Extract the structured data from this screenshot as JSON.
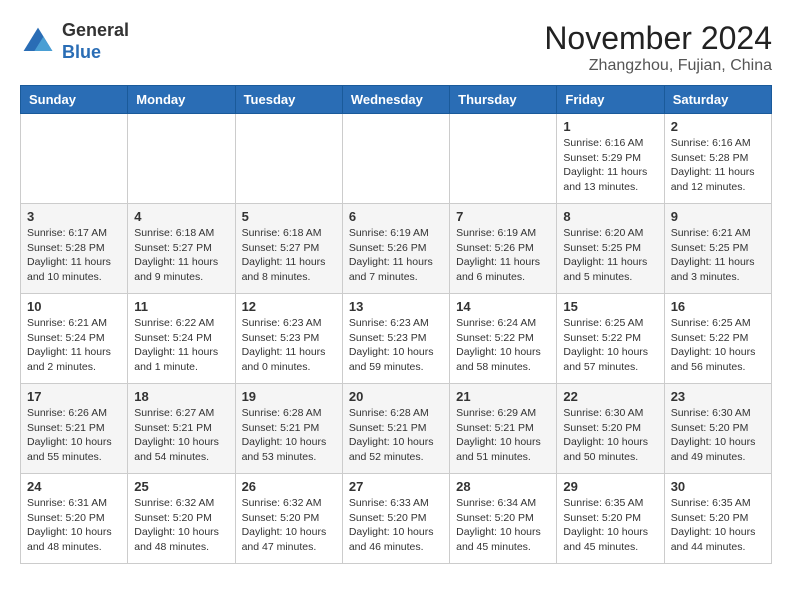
{
  "logo": {
    "text_general": "General",
    "text_blue": "Blue"
  },
  "header": {
    "month": "November 2024",
    "location": "Zhangzhou, Fujian, China"
  },
  "days_of_week": [
    "Sunday",
    "Monday",
    "Tuesday",
    "Wednesday",
    "Thursday",
    "Friday",
    "Saturday"
  ],
  "weeks": [
    [
      {
        "day": "",
        "info": ""
      },
      {
        "day": "",
        "info": ""
      },
      {
        "day": "",
        "info": ""
      },
      {
        "day": "",
        "info": ""
      },
      {
        "day": "",
        "info": ""
      },
      {
        "day": "1",
        "info": "Sunrise: 6:16 AM\nSunset: 5:29 PM\nDaylight: 11 hours and 13 minutes."
      },
      {
        "day": "2",
        "info": "Sunrise: 6:16 AM\nSunset: 5:28 PM\nDaylight: 11 hours and 12 minutes."
      }
    ],
    [
      {
        "day": "3",
        "info": "Sunrise: 6:17 AM\nSunset: 5:28 PM\nDaylight: 11 hours and 10 minutes."
      },
      {
        "day": "4",
        "info": "Sunrise: 6:18 AM\nSunset: 5:27 PM\nDaylight: 11 hours and 9 minutes."
      },
      {
        "day": "5",
        "info": "Sunrise: 6:18 AM\nSunset: 5:27 PM\nDaylight: 11 hours and 8 minutes."
      },
      {
        "day": "6",
        "info": "Sunrise: 6:19 AM\nSunset: 5:26 PM\nDaylight: 11 hours and 7 minutes."
      },
      {
        "day": "7",
        "info": "Sunrise: 6:19 AM\nSunset: 5:26 PM\nDaylight: 11 hours and 6 minutes."
      },
      {
        "day": "8",
        "info": "Sunrise: 6:20 AM\nSunset: 5:25 PM\nDaylight: 11 hours and 5 minutes."
      },
      {
        "day": "9",
        "info": "Sunrise: 6:21 AM\nSunset: 5:25 PM\nDaylight: 11 hours and 3 minutes."
      }
    ],
    [
      {
        "day": "10",
        "info": "Sunrise: 6:21 AM\nSunset: 5:24 PM\nDaylight: 11 hours and 2 minutes."
      },
      {
        "day": "11",
        "info": "Sunrise: 6:22 AM\nSunset: 5:24 PM\nDaylight: 11 hours and 1 minute."
      },
      {
        "day": "12",
        "info": "Sunrise: 6:23 AM\nSunset: 5:23 PM\nDaylight: 11 hours and 0 minutes."
      },
      {
        "day": "13",
        "info": "Sunrise: 6:23 AM\nSunset: 5:23 PM\nDaylight: 10 hours and 59 minutes."
      },
      {
        "day": "14",
        "info": "Sunrise: 6:24 AM\nSunset: 5:22 PM\nDaylight: 10 hours and 58 minutes."
      },
      {
        "day": "15",
        "info": "Sunrise: 6:25 AM\nSunset: 5:22 PM\nDaylight: 10 hours and 57 minutes."
      },
      {
        "day": "16",
        "info": "Sunrise: 6:25 AM\nSunset: 5:22 PM\nDaylight: 10 hours and 56 minutes."
      }
    ],
    [
      {
        "day": "17",
        "info": "Sunrise: 6:26 AM\nSunset: 5:21 PM\nDaylight: 10 hours and 55 minutes."
      },
      {
        "day": "18",
        "info": "Sunrise: 6:27 AM\nSunset: 5:21 PM\nDaylight: 10 hours and 54 minutes."
      },
      {
        "day": "19",
        "info": "Sunrise: 6:28 AM\nSunset: 5:21 PM\nDaylight: 10 hours and 53 minutes."
      },
      {
        "day": "20",
        "info": "Sunrise: 6:28 AM\nSunset: 5:21 PM\nDaylight: 10 hours and 52 minutes."
      },
      {
        "day": "21",
        "info": "Sunrise: 6:29 AM\nSunset: 5:21 PM\nDaylight: 10 hours and 51 minutes."
      },
      {
        "day": "22",
        "info": "Sunrise: 6:30 AM\nSunset: 5:20 PM\nDaylight: 10 hours and 50 minutes."
      },
      {
        "day": "23",
        "info": "Sunrise: 6:30 AM\nSunset: 5:20 PM\nDaylight: 10 hours and 49 minutes."
      }
    ],
    [
      {
        "day": "24",
        "info": "Sunrise: 6:31 AM\nSunset: 5:20 PM\nDaylight: 10 hours and 48 minutes."
      },
      {
        "day": "25",
        "info": "Sunrise: 6:32 AM\nSunset: 5:20 PM\nDaylight: 10 hours and 48 minutes."
      },
      {
        "day": "26",
        "info": "Sunrise: 6:32 AM\nSunset: 5:20 PM\nDaylight: 10 hours and 47 minutes."
      },
      {
        "day": "27",
        "info": "Sunrise: 6:33 AM\nSunset: 5:20 PM\nDaylight: 10 hours and 46 minutes."
      },
      {
        "day": "28",
        "info": "Sunrise: 6:34 AM\nSunset: 5:20 PM\nDaylight: 10 hours and 45 minutes."
      },
      {
        "day": "29",
        "info": "Sunrise: 6:35 AM\nSunset: 5:20 PM\nDaylight: 10 hours and 45 minutes."
      },
      {
        "day": "30",
        "info": "Sunrise: 6:35 AM\nSunset: 5:20 PM\nDaylight: 10 hours and 44 minutes."
      }
    ]
  ]
}
